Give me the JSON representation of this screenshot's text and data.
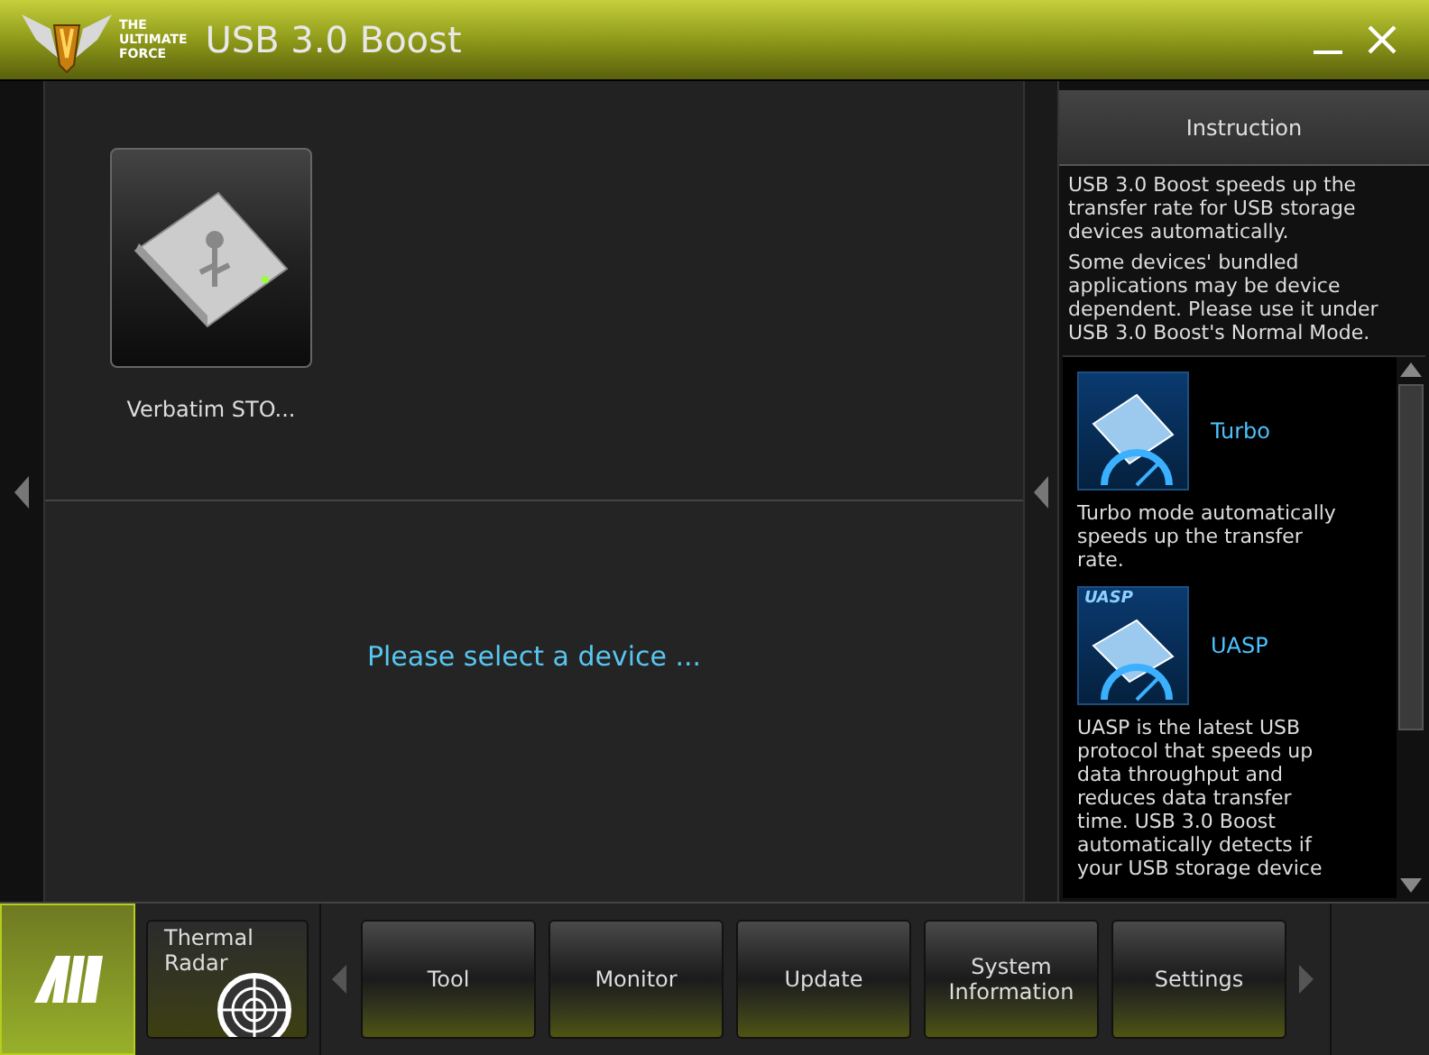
{
  "window": {
    "logo_text": [
      "THE",
      "ULTIMATE",
      "FORCE"
    ],
    "title": "USB 3.0 Boost"
  },
  "devices": [
    {
      "label": "Verbatim STO..."
    }
  ],
  "detail": {
    "message": "Please select a device ..."
  },
  "instruction": {
    "title": "Instruction",
    "paragraphs": [
      "USB 3.0 Boost speeds up the transfer rate for USB storage devices automatically.",
      "Some devices' bundled applications may be device dependent. Please use it under USB 3.0 Boost's Normal Mode."
    ],
    "modes": [
      {
        "kind": "turbo",
        "name": "Turbo",
        "description": "Turbo mode automatically speeds up the transfer rate."
      },
      {
        "kind": "uasp",
        "name": "UASP",
        "badge": "UASP",
        "description": "UASP is the latest USB protocol that speeds up data throughput and reduces data transfer time. USB 3.0 Boost automatically detects if your USB storage device"
      }
    ]
  },
  "bottom_bar": {
    "shortcut": {
      "label": "Thermal Radar"
    },
    "nav": [
      "Tool",
      "Monitor",
      "Update",
      "System Information",
      "Settings"
    ]
  }
}
